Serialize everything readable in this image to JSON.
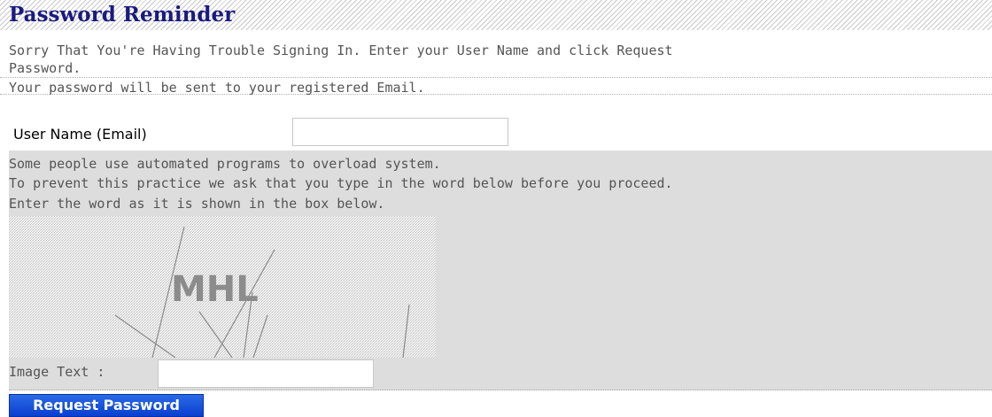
{
  "header": {
    "title": "Password Reminder"
  },
  "intro": {
    "line1": "Sorry That You're Having Trouble Signing In. Enter your User Name and click Request",
    "line2": "Password.",
    "line3": "Your password will be sent to your registered Email."
  },
  "user": {
    "label": "User Name (Email)",
    "value": "",
    "placeholder": ""
  },
  "captcha": {
    "line1": "Some people use automated programs to overload system.",
    "line2": "To prevent this practice we ask that you type in the word below before you proceed.",
    "line3": "Enter the word as it is shown in the box below.",
    "image_word": "MHL",
    "image_text_label": "Image Text :",
    "image_text_value": ""
  },
  "actions": {
    "request_label": "Request Password"
  },
  "colors": {
    "title": "#1a1a80",
    "panel_bg": "#dddddd",
    "button_bg": "#0a3fd0",
    "body_text": "#555555"
  }
}
